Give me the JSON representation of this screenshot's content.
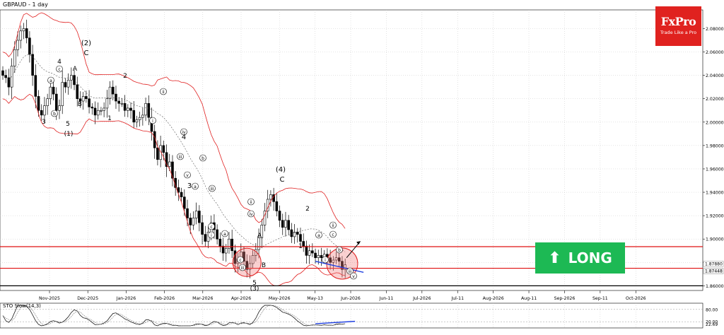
{
  "header": {
    "symbol_title": "GBPAUD - 1 day"
  },
  "brand": {
    "name": "FxPro",
    "tagline": "Trade Like a Pro",
    "color": "#e0221f"
  },
  "signal": {
    "label": "LONG",
    "arrow": "up-arrow-icon",
    "color": "#1db954"
  },
  "indicator": {
    "title": "STO Slow(14,3)",
    "upper_level": 80,
    "lower_level": 20,
    "scale_ticks": [
      "80.00",
      "20.00",
      "22.69"
    ]
  },
  "chart_data": {
    "type": "candlestick",
    "instrument": "GBPAUD",
    "timeframe": "1 day",
    "ylim": [
      1.856,
      2.096
    ],
    "y_ticks": [
      "2.08000",
      "2.06000",
      "2.04000",
      "2.02000",
      "2.00000",
      "1.98000",
      "1.96000",
      "1.94000",
      "1.92000",
      "1.90000",
      "1.88000",
      "1.86000"
    ],
    "price_labels": [
      "1.87880",
      "1.87448"
    ],
    "x_ticks": [
      "Nov-2025",
      "Dec-2025",
      "Jan-2026",
      "Feb-2026",
      "Mar-2026",
      "Apr-2026",
      "May-2026",
      "May-13",
      "Jun-2026",
      "Jun-11",
      "Jul-2026",
      "Jul-11",
      "Aug-2026",
      "Aug-11",
      "Sep-2026",
      "Sep-11",
      "Oct-2026"
    ],
    "horizontal_lines": [
      {
        "value": 1.8935,
        "color": "#e01010"
      },
      {
        "value": 1.875,
        "color": "#e01010"
      },
      {
        "value": 1.86,
        "color": "#000000"
      }
    ],
    "closes": [
      2.04,
      2.038,
      2.03,
      2.048,
      2.062,
      2.07,
      2.078,
      2.08,
      2.072,
      2.058,
      2.04,
      2.022,
      2.01,
      2.006,
      2.014,
      2.02,
      2.03,
      2.024,
      2.01,
      2.014,
      2.034,
      2.03,
      2.036,
      2.04,
      2.032,
      2.02,
      2.018,
      2.022,
      2.02,
      2.013,
      2.012,
      2.006,
      2.01,
      2.01,
      2.012,
      2.02,
      2.03,
      2.024,
      2.018,
      2.016,
      2.016,
      2.01,
      2.012,
      2.01,
      2.0,
      2.002,
      2.004,
      2.006,
      2.016,
      2.004,
      1.992,
      1.978,
      1.968,
      1.98,
      1.974,
      1.962,
      1.966,
      1.952,
      1.944,
      1.94,
      1.936,
      1.926,
      1.918,
      1.912,
      1.918,
      1.924,
      1.914,
      1.904,
      1.898,
      1.906,
      1.914,
      1.908,
      1.9,
      1.894,
      1.888,
      1.892,
      1.9,
      1.89,
      1.879,
      1.883,
      1.889,
      1.881,
      1.874,
      1.879,
      1.886,
      1.891,
      1.901,
      1.912,
      1.924,
      1.934,
      1.938,
      1.932,
      1.924,
      1.916,
      1.91,
      1.916,
      1.908,
      1.902,
      1.906,
      1.904,
      1.898,
      1.894,
      1.886,
      1.89,
      1.888,
      1.884,
      1.886,
      1.884,
      1.887,
      1.884,
      1.88,
      1.882,
      1.884,
      1.881,
      1.874,
      1.878
    ],
    "annotations": [
      "(2)",
      "C",
      "4",
      "c",
      "A",
      "B",
      "a",
      "b",
      "3",
      "5",
      "(1)",
      "2",
      "1",
      "ii",
      "i",
      "iv",
      "4",
      "iii",
      "v",
      "b",
      "3",
      "a",
      "iii",
      "c",
      "i",
      "ii",
      "a",
      "iv",
      "c",
      "iii",
      "A",
      "B",
      "5",
      "(3)",
      "(4)",
      "C",
      "2",
      "1",
      "a",
      "c",
      "ii",
      "b",
      "i",
      "iii",
      "v"
    ]
  }
}
